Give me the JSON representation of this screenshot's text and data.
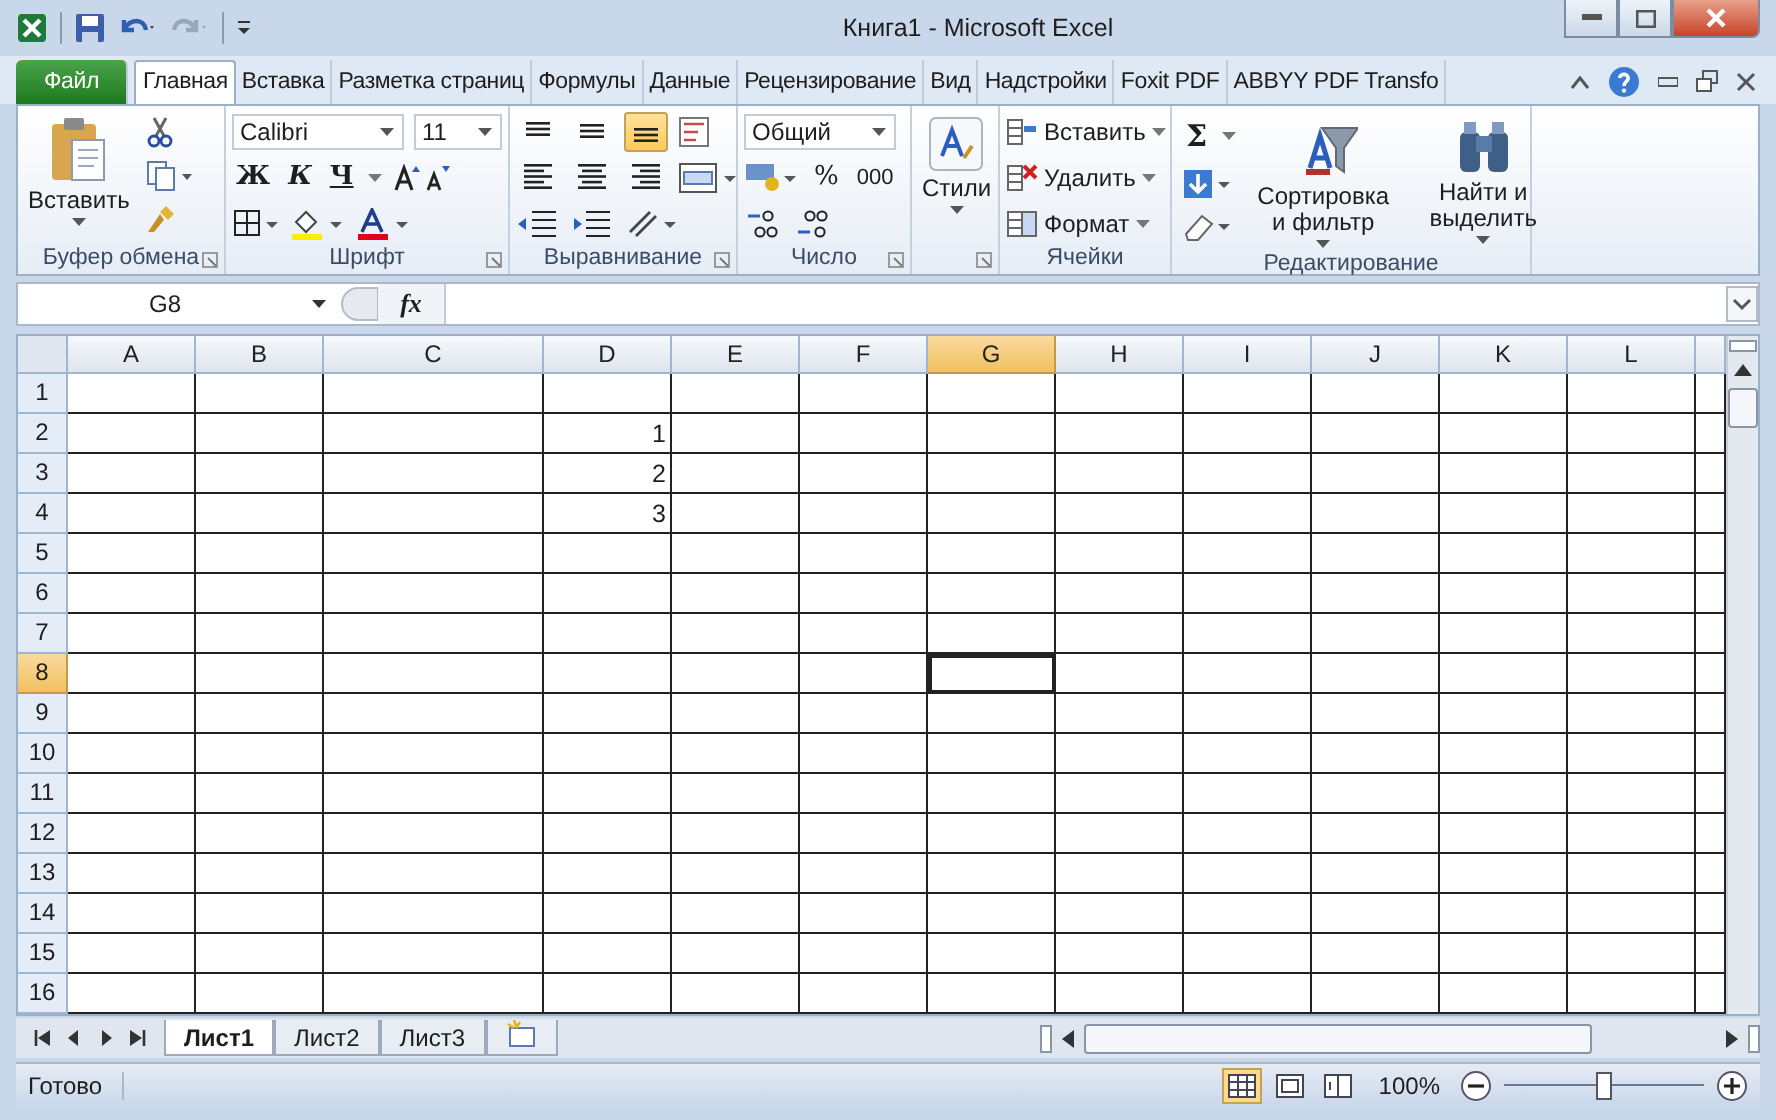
{
  "window": {
    "title": "Книга1  -  Microsoft Excel"
  },
  "tabs": [
    {
      "label": "Файл",
      "kind": "file",
      "selected": false
    },
    {
      "label": "Главная",
      "kind": "tab",
      "selected": true
    },
    {
      "label": "Вставка",
      "kind": "tab",
      "selected": false
    },
    {
      "label": "Разметка страниц",
      "kind": "tab",
      "selected": false
    },
    {
      "label": "Формулы",
      "kind": "tab",
      "selected": false
    },
    {
      "label": "Данные",
      "kind": "tab",
      "selected": false
    },
    {
      "label": "Рецензирование",
      "kind": "tab",
      "selected": false
    },
    {
      "label": "Вид",
      "kind": "tab",
      "selected": false
    },
    {
      "label": "Надстройки",
      "kind": "tab",
      "selected": false
    },
    {
      "label": "Foxit PDF",
      "kind": "tab",
      "selected": false
    },
    {
      "label": "ABBYY PDF Transfo",
      "kind": "tab",
      "selected": false
    }
  ],
  "ribbon": {
    "clipboard": {
      "label": "Буфер обмена",
      "paste": "Вставить"
    },
    "font": {
      "label": "Шрифт",
      "family": "Calibri",
      "size": "11",
      "bold": "Ж",
      "italic": "К",
      "underline": "Ч"
    },
    "alignment": {
      "label": "Выравнивание",
      "buttons": [
        {
          "selected": false
        },
        {
          "selected": false
        },
        {
          "selected": true
        }
      ]
    },
    "number": {
      "label": "Число",
      "format": "Общий",
      "percent": "%",
      "thousands": "000"
    },
    "styles": {
      "label": "Стили"
    },
    "cells": {
      "label": "Ячейки",
      "insert": "Вставить",
      "delete": "Удалить",
      "format": "Формат"
    },
    "editing": {
      "label": "Редактирование",
      "sum": "Σ",
      "sort": "Сортировка и фильтр",
      "find": "Найти и выделить"
    }
  },
  "formula_bar": {
    "name_box": "G8",
    "fx": "fx"
  },
  "columns": [
    {
      "label": "A",
      "selected": false
    },
    {
      "label": "B",
      "selected": false
    },
    {
      "label": "C",
      "selected": false
    },
    {
      "label": "D",
      "selected": false
    },
    {
      "label": "E",
      "selected": false
    },
    {
      "label": "F",
      "selected": false
    },
    {
      "label": "G",
      "selected": true
    },
    {
      "label": "H",
      "selected": false
    },
    {
      "label": "I",
      "selected": false
    },
    {
      "label": "J",
      "selected": false
    },
    {
      "label": "K",
      "selected": false
    },
    {
      "label": "L",
      "selected": false
    }
  ],
  "rows": [
    {
      "number": "1",
      "selected": false,
      "cells": []
    },
    {
      "number": "2",
      "selected": false,
      "cells": [
        null,
        null,
        null,
        "1"
      ]
    },
    {
      "number": "3",
      "selected": false,
      "cells": [
        null,
        null,
        null,
        "2"
      ]
    },
    {
      "number": "4",
      "selected": false,
      "cells": [
        null,
        null,
        null,
        "3"
      ]
    },
    {
      "number": "5",
      "selected": false,
      "cells": []
    },
    {
      "number": "6",
      "selected": false,
      "cells": []
    },
    {
      "number": "7",
      "selected": false,
      "cells": []
    },
    {
      "number": "8",
      "selected": true,
      "cells": []
    },
    {
      "number": "9",
      "selected": false,
      "cells": []
    },
    {
      "number": "10",
      "selected": false,
      "cells": []
    },
    {
      "number": "11",
      "selected": false,
      "cells": []
    },
    {
      "number": "12",
      "selected": false,
      "cells": []
    },
    {
      "number": "13",
      "selected": false,
      "cells": []
    },
    {
      "number": "14",
      "selected": false,
      "cells": []
    },
    {
      "number": "15",
      "selected": false,
      "cells": []
    },
    {
      "number": "16",
      "selected": false,
      "cells": []
    }
  ],
  "sheets": [
    {
      "label": "Лист1",
      "selected": true
    },
    {
      "label": "Лист2",
      "selected": false
    },
    {
      "label": "Лист3",
      "selected": false
    }
  ],
  "status_bar": {
    "text": "Готово",
    "views": [
      {
        "selected": true
      },
      {
        "selected": false
      },
      {
        "selected": false
      }
    ],
    "zoom": "100%",
    "level": 0.5
  }
}
